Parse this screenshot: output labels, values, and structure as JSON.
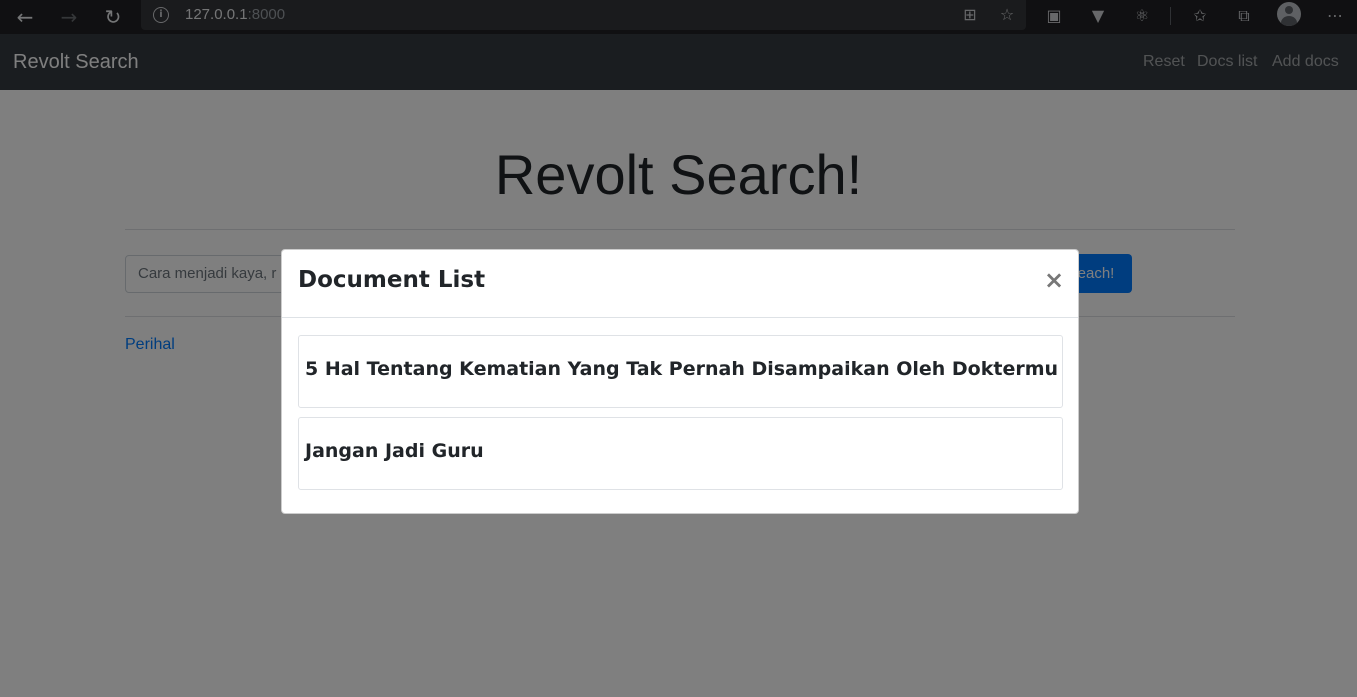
{
  "browser": {
    "url_host": "127.0.0.1",
    "url_port": ":8000"
  },
  "navbar": {
    "brand": "Revolt Search",
    "links": [
      "Reset",
      "Docs list",
      "Add docs"
    ]
  },
  "main": {
    "heading": "Revolt Search!",
    "search_value": "Cara menjadi kaya, r",
    "search_button": "Seach!",
    "perihal_link": "Perihal"
  },
  "modal": {
    "title": "Document List",
    "close": "×",
    "documents": [
      "5 Hal Tentang Kematian Yang Tak Pernah Disampaikan Oleh Doktermu",
      "Jangan Jadi Guru"
    ]
  }
}
